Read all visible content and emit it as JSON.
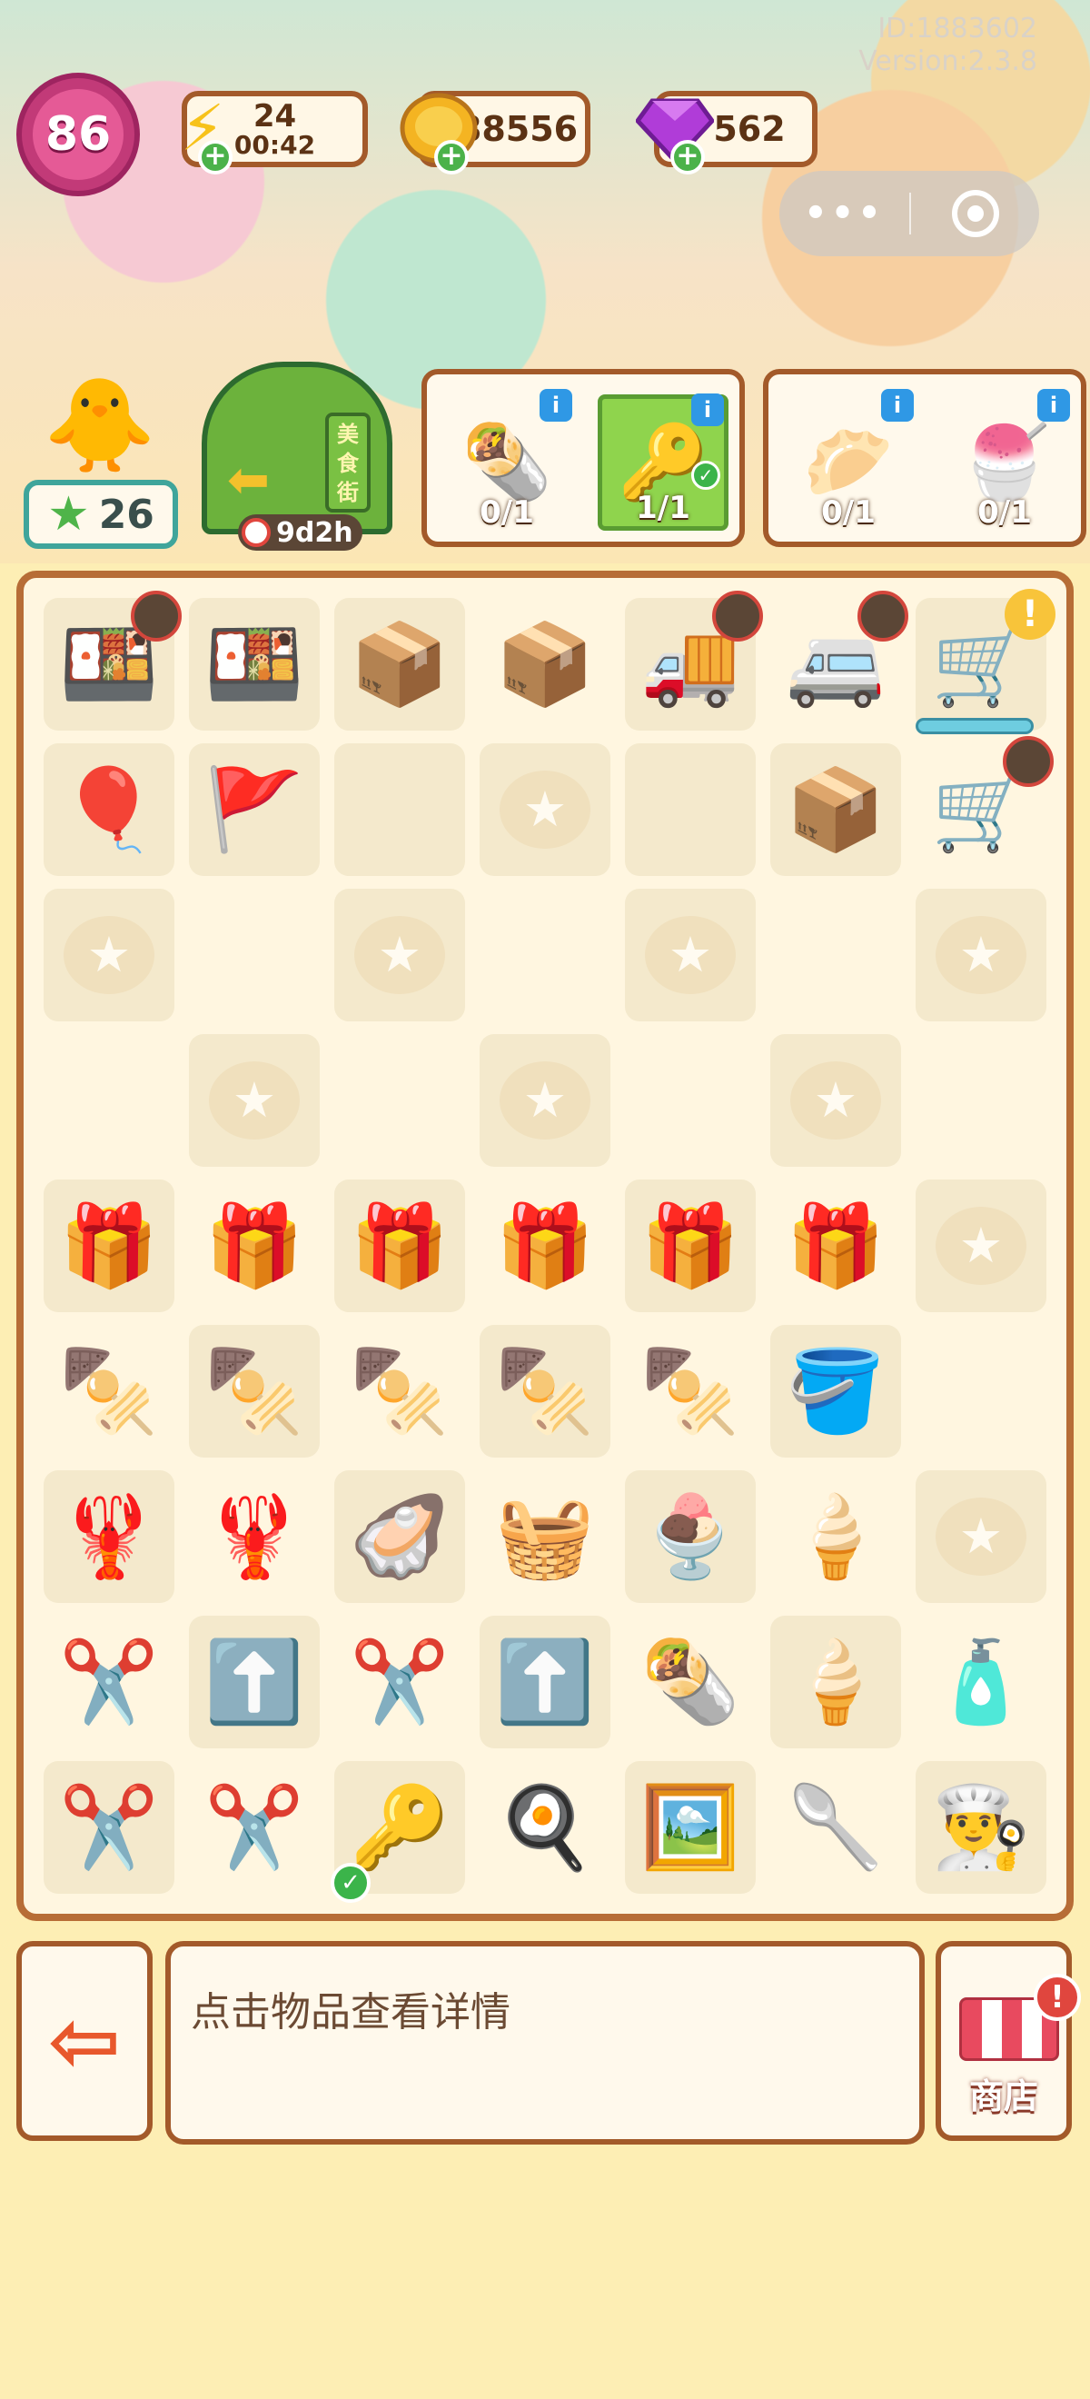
{
  "header": {
    "id_text": "ID:1883602",
    "version_text": "Version:2.3.8"
  },
  "resources": {
    "level": "86",
    "energy": "24",
    "energy_timer": "00:42",
    "coins": "88556",
    "gems": "562"
  },
  "capsule": {
    "more_label": "•••"
  },
  "side": {
    "stars": "26",
    "gate_sign": "美食街",
    "gate_timer": "9d2h"
  },
  "orders": [
    {
      "items": [
        {
          "icon": "🌯",
          "count": "0/1",
          "ready": false
        },
        {
          "icon": "🔑",
          "count": "1/1",
          "ready": true
        }
      ]
    },
    {
      "items": [
        {
          "icon": "🥟",
          "count": "0/1",
          "ready": false
        },
        {
          "icon": "🍧",
          "count": "0/1",
          "ready": false
        }
      ]
    }
  ],
  "board": {
    "rows": [
      [
        {
          "icon": "🍱",
          "bg": "light",
          "badge": "timer"
        },
        {
          "icon": "🍱",
          "bg": "light"
        },
        {
          "icon": "📦",
          "bg": "light"
        },
        {
          "icon": "📦",
          "bg": "dark"
        },
        {
          "icon": "🚚",
          "bg": "light",
          "badge": "timer"
        },
        {
          "icon": "🚐",
          "bg": "dark",
          "badge": "timer"
        },
        {
          "icon": "🛒",
          "bg": "light",
          "badge": "alert",
          "alert": "!",
          "bar": true
        }
      ],
      [
        {
          "icon": "🎈",
          "bg": "light"
        },
        {
          "icon": "🚩",
          "bg": "light"
        },
        {
          "icon": "",
          "bg": "light"
        },
        {
          "locked": true,
          "bg": "light"
        },
        {
          "icon": "",
          "bg": "light"
        },
        {
          "icon": "📦",
          "bg": "light"
        },
        {
          "icon": "🛒",
          "bg": "dark",
          "badge": "timer"
        }
      ],
      [
        {
          "locked": true,
          "bg": "light"
        },
        {
          "icon": "",
          "bg": "dark"
        },
        {
          "locked": true,
          "bg": "light"
        },
        {
          "icon": "",
          "bg": "dark"
        },
        {
          "locked": true,
          "bg": "light"
        },
        {
          "icon": "",
          "bg": "dark"
        },
        {
          "locked": true,
          "bg": "light"
        }
      ],
      [
        {
          "icon": "",
          "bg": "dark"
        },
        {
          "locked": true,
          "bg": "light"
        },
        {
          "icon": "",
          "bg": "dark"
        },
        {
          "locked": true,
          "bg": "light"
        },
        {
          "icon": "",
          "bg": "dark"
        },
        {
          "locked": true,
          "bg": "light"
        },
        {
          "icon": "",
          "bg": "dark"
        }
      ],
      [
        {
          "icon": "🎁",
          "bg": "light"
        },
        {
          "icon": "🎁",
          "bg": "dark"
        },
        {
          "icon": "🎁",
          "bg": "light"
        },
        {
          "icon": "🎁",
          "bg": "dark"
        },
        {
          "icon": "🎁",
          "bg": "light"
        },
        {
          "icon": "🎁",
          "bg": "dark"
        },
        {
          "locked": true,
          "bg": "light"
        }
      ],
      [
        {
          "icon": "🍢",
          "bg": "dark"
        },
        {
          "icon": "🍢",
          "bg": "light"
        },
        {
          "icon": "🍢",
          "bg": "dark"
        },
        {
          "icon": "🍢",
          "bg": "light"
        },
        {
          "icon": "🍢",
          "bg": "dark"
        },
        {
          "icon": "🪣",
          "bg": "light"
        },
        {
          "icon": "",
          "bg": "dark"
        }
      ],
      [
        {
          "icon": "🦞",
          "bg": "light"
        },
        {
          "icon": "🦞",
          "bg": "dark"
        },
        {
          "icon": "🦪",
          "bg": "light"
        },
        {
          "icon": "🧺",
          "bg": "dark"
        },
        {
          "icon": "🍨",
          "bg": "light"
        },
        {
          "icon": "🍦",
          "bg": "dark"
        },
        {
          "locked": true,
          "bg": "light"
        }
      ],
      [
        {
          "icon": "✂️",
          "bg": "dark"
        },
        {
          "icon": "⬆️",
          "bg": "light"
        },
        {
          "icon": "✂️",
          "bg": "dark"
        },
        {
          "icon": "⬆️",
          "bg": "light"
        },
        {
          "icon": "🌯",
          "bg": "dark"
        },
        {
          "icon": "🍦",
          "bg": "light"
        },
        {
          "icon": "🧴",
          "bg": "dark"
        }
      ],
      [
        {
          "icon": "✂️",
          "bg": "light"
        },
        {
          "icon": "✂️",
          "bg": "dark"
        },
        {
          "icon": "🔑",
          "bg": "light",
          "badge": "check"
        },
        {
          "icon": "🍳",
          "bg": "dark"
        },
        {
          "icon": "🖼️",
          "bg": "light"
        },
        {
          "icon": "🥄",
          "bg": "dark"
        },
        {
          "icon": "👨‍🍳",
          "bg": "light"
        }
      ]
    ]
  },
  "bottom": {
    "hint": "点击物品查看详情",
    "shop_label": "商店",
    "shop_badge": "!"
  },
  "colors": {
    "frame": "#a35a2a",
    "board_bg": "#fff6e0",
    "cell_light": "#f4e9cc",
    "level": "#c23a78",
    "plus": "#4bb24a"
  }
}
